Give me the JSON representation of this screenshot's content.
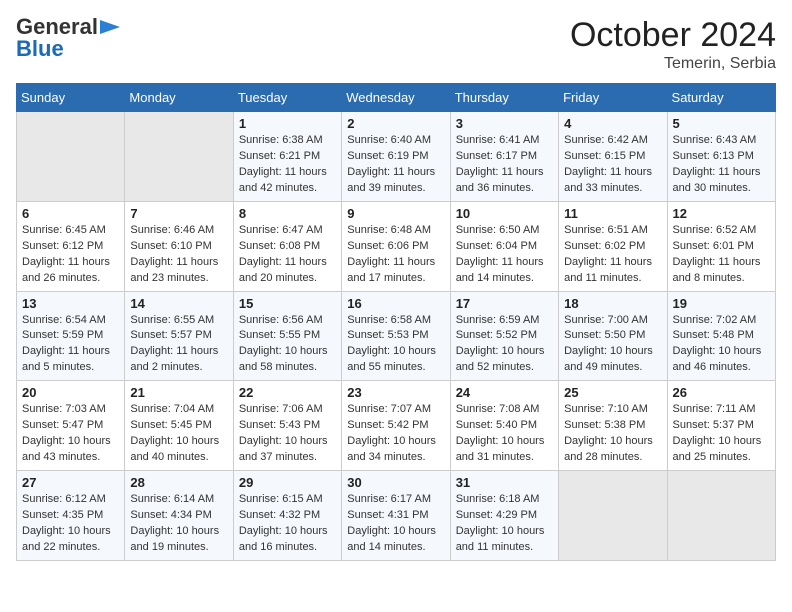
{
  "header": {
    "logo_general": "General",
    "logo_blue": "Blue",
    "month": "October 2024",
    "location": "Temerin, Serbia"
  },
  "weekdays": [
    "Sunday",
    "Monday",
    "Tuesday",
    "Wednesday",
    "Thursday",
    "Friday",
    "Saturday"
  ],
  "weeks": [
    [
      {
        "day": "",
        "empty": true
      },
      {
        "day": "",
        "empty": true
      },
      {
        "day": "1",
        "sunrise": "6:38 AM",
        "sunset": "6:21 PM",
        "daylight": "11 hours and 42 minutes."
      },
      {
        "day": "2",
        "sunrise": "6:40 AM",
        "sunset": "6:19 PM",
        "daylight": "11 hours and 39 minutes."
      },
      {
        "day": "3",
        "sunrise": "6:41 AM",
        "sunset": "6:17 PM",
        "daylight": "11 hours and 36 minutes."
      },
      {
        "day": "4",
        "sunrise": "6:42 AM",
        "sunset": "6:15 PM",
        "daylight": "11 hours and 33 minutes."
      },
      {
        "day": "5",
        "sunrise": "6:43 AM",
        "sunset": "6:13 PM",
        "daylight": "11 hours and 30 minutes."
      }
    ],
    [
      {
        "day": "6",
        "sunrise": "6:45 AM",
        "sunset": "6:12 PM",
        "daylight": "11 hours and 26 minutes."
      },
      {
        "day": "7",
        "sunrise": "6:46 AM",
        "sunset": "6:10 PM",
        "daylight": "11 hours and 23 minutes."
      },
      {
        "day": "8",
        "sunrise": "6:47 AM",
        "sunset": "6:08 PM",
        "daylight": "11 hours and 20 minutes."
      },
      {
        "day": "9",
        "sunrise": "6:48 AM",
        "sunset": "6:06 PM",
        "daylight": "11 hours and 17 minutes."
      },
      {
        "day": "10",
        "sunrise": "6:50 AM",
        "sunset": "6:04 PM",
        "daylight": "11 hours and 14 minutes."
      },
      {
        "day": "11",
        "sunrise": "6:51 AM",
        "sunset": "6:02 PM",
        "daylight": "11 hours and 11 minutes."
      },
      {
        "day": "12",
        "sunrise": "6:52 AM",
        "sunset": "6:01 PM",
        "daylight": "11 hours and 8 minutes."
      }
    ],
    [
      {
        "day": "13",
        "sunrise": "6:54 AM",
        "sunset": "5:59 PM",
        "daylight": "11 hours and 5 minutes."
      },
      {
        "day": "14",
        "sunrise": "6:55 AM",
        "sunset": "5:57 PM",
        "daylight": "11 hours and 2 minutes."
      },
      {
        "day": "15",
        "sunrise": "6:56 AM",
        "sunset": "5:55 PM",
        "daylight": "10 hours and 58 minutes."
      },
      {
        "day": "16",
        "sunrise": "6:58 AM",
        "sunset": "5:53 PM",
        "daylight": "10 hours and 55 minutes."
      },
      {
        "day": "17",
        "sunrise": "6:59 AM",
        "sunset": "5:52 PM",
        "daylight": "10 hours and 52 minutes."
      },
      {
        "day": "18",
        "sunrise": "7:00 AM",
        "sunset": "5:50 PM",
        "daylight": "10 hours and 49 minutes."
      },
      {
        "day": "19",
        "sunrise": "7:02 AM",
        "sunset": "5:48 PM",
        "daylight": "10 hours and 46 minutes."
      }
    ],
    [
      {
        "day": "20",
        "sunrise": "7:03 AM",
        "sunset": "5:47 PM",
        "daylight": "10 hours and 43 minutes."
      },
      {
        "day": "21",
        "sunrise": "7:04 AM",
        "sunset": "5:45 PM",
        "daylight": "10 hours and 40 minutes."
      },
      {
        "day": "22",
        "sunrise": "7:06 AM",
        "sunset": "5:43 PM",
        "daylight": "10 hours and 37 minutes."
      },
      {
        "day": "23",
        "sunrise": "7:07 AM",
        "sunset": "5:42 PM",
        "daylight": "10 hours and 34 minutes."
      },
      {
        "day": "24",
        "sunrise": "7:08 AM",
        "sunset": "5:40 PM",
        "daylight": "10 hours and 31 minutes."
      },
      {
        "day": "25",
        "sunrise": "7:10 AM",
        "sunset": "5:38 PM",
        "daylight": "10 hours and 28 minutes."
      },
      {
        "day": "26",
        "sunrise": "7:11 AM",
        "sunset": "5:37 PM",
        "daylight": "10 hours and 25 minutes."
      }
    ],
    [
      {
        "day": "27",
        "sunrise": "6:12 AM",
        "sunset": "4:35 PM",
        "daylight": "10 hours and 22 minutes."
      },
      {
        "day": "28",
        "sunrise": "6:14 AM",
        "sunset": "4:34 PM",
        "daylight": "10 hours and 19 minutes."
      },
      {
        "day": "29",
        "sunrise": "6:15 AM",
        "sunset": "4:32 PM",
        "daylight": "10 hours and 16 minutes."
      },
      {
        "day": "30",
        "sunrise": "6:17 AM",
        "sunset": "4:31 PM",
        "daylight": "10 hours and 14 minutes."
      },
      {
        "day": "31",
        "sunrise": "6:18 AM",
        "sunset": "4:29 PM",
        "daylight": "10 hours and 11 minutes."
      },
      {
        "day": "",
        "empty": true
      },
      {
        "day": "",
        "empty": true
      }
    ]
  ]
}
